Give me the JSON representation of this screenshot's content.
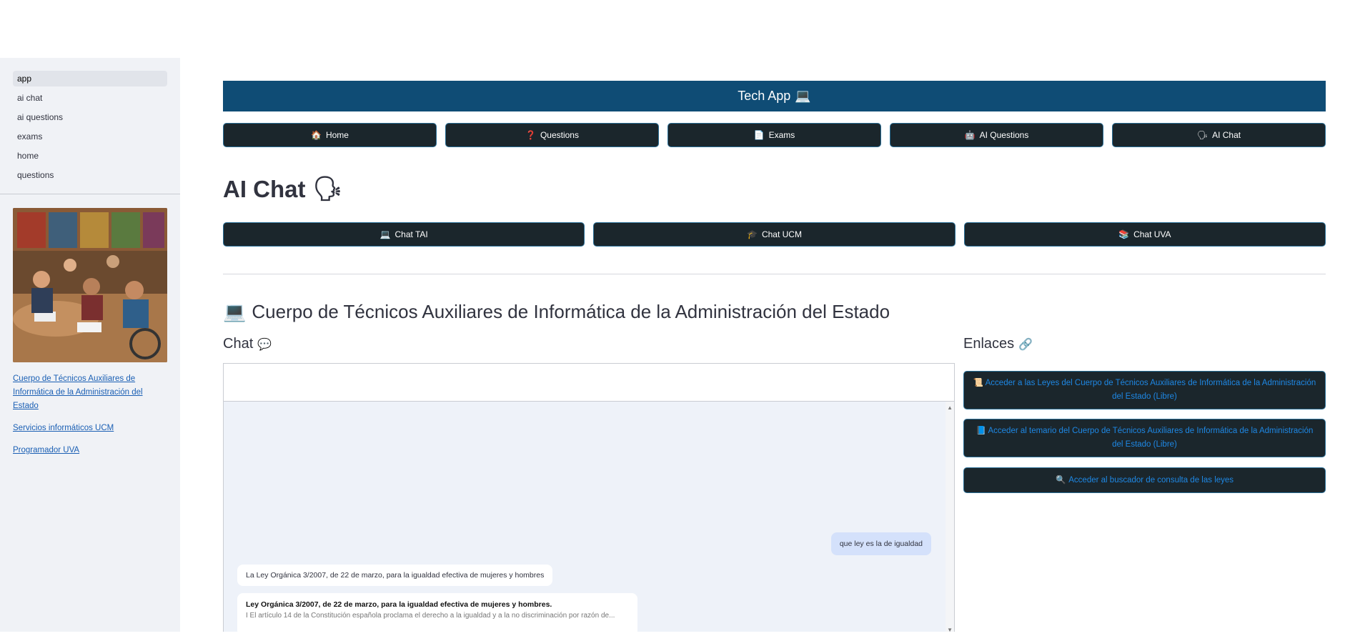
{
  "sidebar": {
    "nav": [
      {
        "label": "app",
        "active": true
      },
      {
        "label": "ai chat"
      },
      {
        "label": "ai questions"
      },
      {
        "label": "exams"
      },
      {
        "label": "home"
      },
      {
        "label": "questions"
      }
    ],
    "links": [
      "Cuerpo de Técnicos Auxiliares de Informática de la Administración del Estado",
      "Servicios informáticos UCM",
      "Programador UVA"
    ]
  },
  "banner": {
    "title": "Tech App",
    "icon": "💻"
  },
  "top_nav": [
    {
      "label": "Home",
      "icon": "🏠"
    },
    {
      "label": "Questions",
      "icon": "❓"
    },
    {
      "label": "Exams",
      "icon": "📄"
    },
    {
      "label": "AI Questions",
      "icon": "🤖"
    },
    {
      "label": "AI Chat",
      "icon": "🗣"
    }
  ],
  "page_title": {
    "text": "AI Chat",
    "icon": "🗣"
  },
  "chat_tabs": [
    {
      "label": "Chat TAI",
      "icon": "💻"
    },
    {
      "label": "Chat UCM",
      "icon": "🎓"
    },
    {
      "label": "Chat UVA",
      "icon": "📚"
    }
  ],
  "section_title": {
    "text": "Cuerpo de Técnicos Auxiliares de Informática de la Administración del Estado",
    "icon": "💻"
  },
  "chat": {
    "title": "Chat",
    "icon": "💬",
    "messages": {
      "user": "que ley es la de igualdad",
      "bot": "La Ley Orgánica 3/2007, de 22 de marzo, para la igualdad efectiva de mujeres y hombres",
      "card_title": "Ley Orgánica 3/2007, de 22 de marzo, para la igualdad efectiva de mujeres y hombres.",
      "card_snippet": "I El artículo 14 de la Constitución española proclama el derecho a la igualdad y a la no discriminación por razón de..."
    }
  },
  "links": {
    "title": "Enlaces",
    "icon": "🔗",
    "items": [
      {
        "icon": "📜",
        "label": "Acceder a las Leyes del Cuerpo de Técnicos Auxiliares de Informática de la Administración del Estado (Libre)"
      },
      {
        "icon": "📘",
        "label": "Acceder al temario del Cuerpo de Técnicos Auxiliares de Informática de la Administración del Estado (Libre)"
      },
      {
        "icon": "🔍",
        "label": "Acceder al buscador de consulta de las leyes"
      }
    ]
  },
  "colors": {
    "banner": "#0f4c75",
    "button": "#1b262c",
    "link": "#1e88e5",
    "sidebar": "#f0f2f6"
  }
}
